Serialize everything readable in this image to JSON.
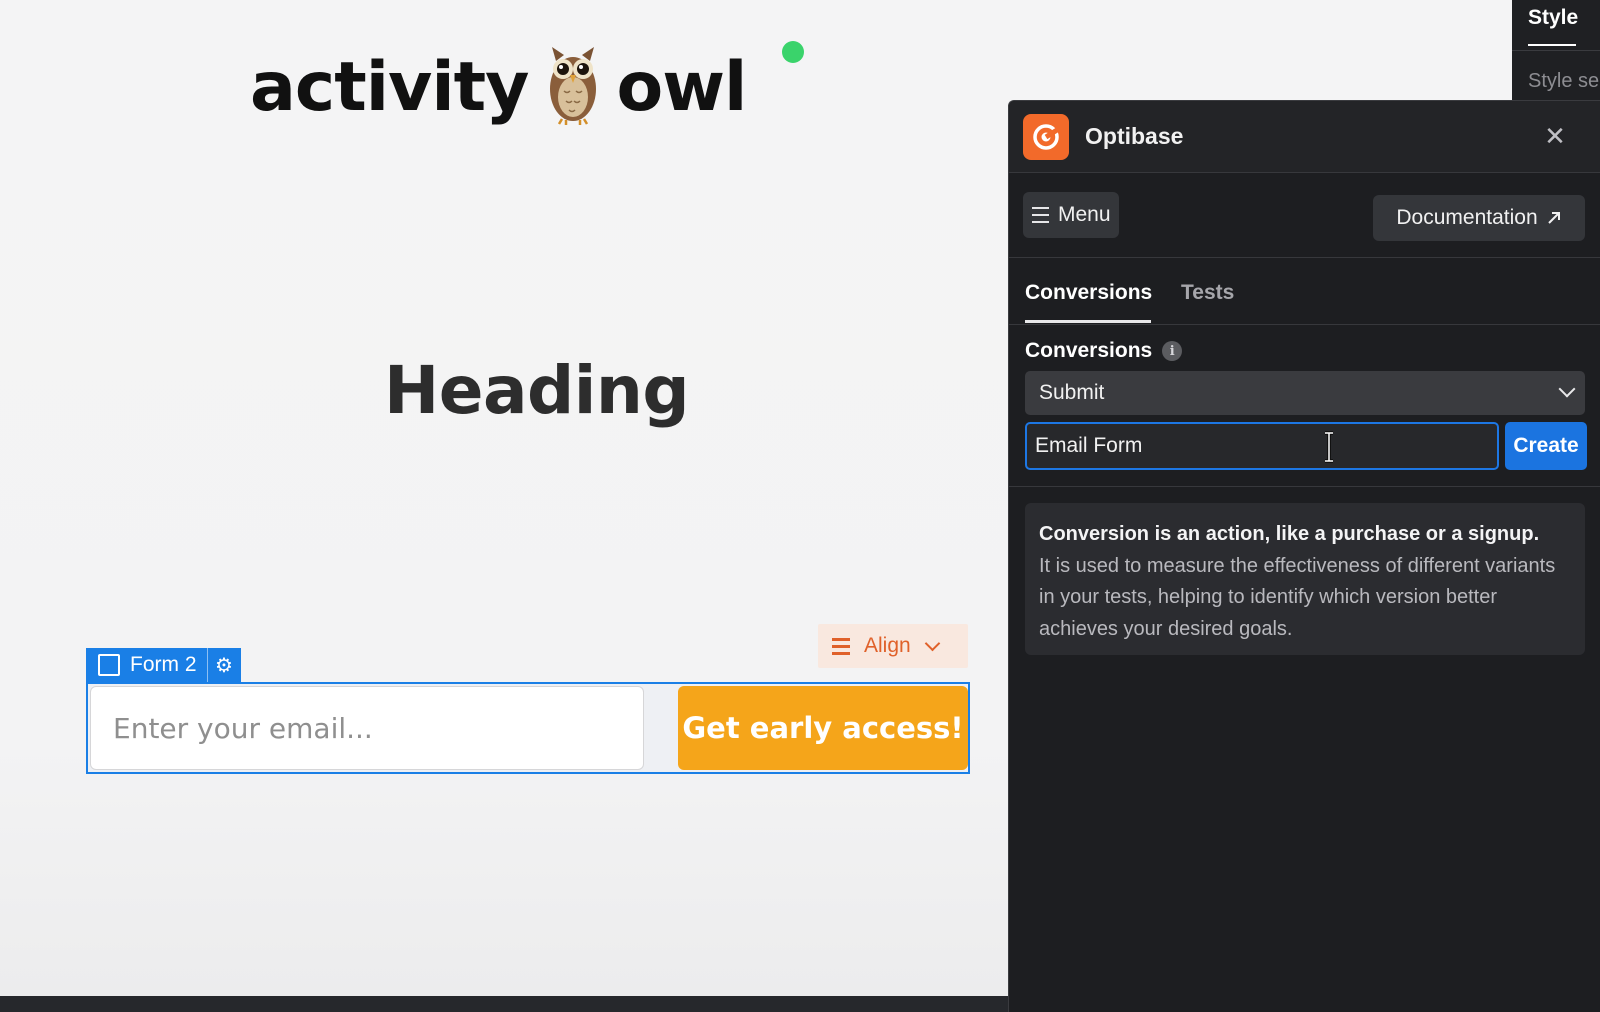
{
  "canvas": {
    "logo": {
      "word_left": "activity",
      "word_right": "owl",
      "owl_icon": "owl-emoji"
    },
    "heading": "Heading",
    "align_button": {
      "label": "Align"
    },
    "form_tag": {
      "label": "Form 2"
    },
    "email_input": {
      "placeholder": "Enter your email..."
    },
    "cta_button": {
      "label": "Get early access!"
    }
  },
  "style_panel": {
    "tab": "Style",
    "subtitle": "Style se"
  },
  "optibase": {
    "title": "Optibase",
    "menu_label": "Menu",
    "documentation_label": "Documentation",
    "tabs": [
      {
        "label": "Conversions",
        "active": true
      },
      {
        "label": "Tests",
        "active": false
      }
    ],
    "section_label": "Conversions",
    "conversion_select": {
      "selected": "Submit"
    },
    "name_input": {
      "value": "Email Form"
    },
    "create_label": "Create",
    "info": {
      "headline": "Conversion is an action, like a purchase or a signup.",
      "body": "It is used to measure the effectiveness of different variants in your tests, helping to identify which version better achieves your desired goals."
    }
  },
  "colors": {
    "cta": "#f5a51a",
    "selection_blue": "#1a7fe6",
    "optibase_orange": "#f26a2a",
    "status_dot": "#3ad36b",
    "panel_bg": "#1d1e21"
  }
}
